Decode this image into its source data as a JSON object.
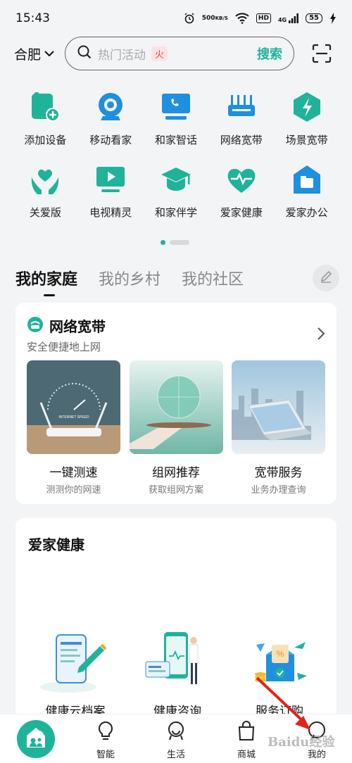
{
  "status_bar": {
    "time": "15:43",
    "net_speed_value": "500",
    "net_speed_unit": "KB/S",
    "hd": "HD",
    "signal": "4G",
    "battery": "55"
  },
  "search": {
    "city": "合肥",
    "placeholder": "热门活动",
    "hot_badge": "火",
    "button": "搜索"
  },
  "functions": [
    {
      "label": "添加设备",
      "icon": "add-device-icon"
    },
    {
      "label": "移动看家",
      "icon": "camera-icon"
    },
    {
      "label": "和家智话",
      "icon": "phone-screen-icon"
    },
    {
      "label": "网络宽带",
      "icon": "router-icon"
    },
    {
      "label": "场景宽带",
      "icon": "lightning-icon"
    },
    {
      "label": "关爱版",
      "icon": "care-hands-icon"
    },
    {
      "label": "电视精灵",
      "icon": "tv-icon"
    },
    {
      "label": "和家伴学",
      "icon": "graduation-cap-icon"
    },
    {
      "label": "爱家健康",
      "icon": "heart-pulse-icon"
    },
    {
      "label": "爱家办公",
      "icon": "office-folder-icon"
    }
  ],
  "tabs": [
    "我的家庭",
    "我的乡村",
    "我的社区"
  ],
  "broadband_card": {
    "title": "网络宽带",
    "subtitle": "安全便捷地上网",
    "items": [
      {
        "name": "一键测速",
        "desc": "测测你的网速",
        "img_text": "INTERNET SPEED"
      },
      {
        "name": "组网推荐",
        "desc": "获取组网方案"
      },
      {
        "name": "宽带服务",
        "desc": "业务办理查询"
      }
    ]
  },
  "health_card": {
    "title": "爱家健康",
    "items": [
      {
        "name": "健康云档案"
      },
      {
        "name": "健康咨询"
      },
      {
        "name": "服务订购"
      }
    ]
  },
  "bottom_nav": [
    {
      "label": "智能",
      "icon": "bulb-icon"
    },
    {
      "label": "生活",
      "icon": "smile-icon"
    },
    {
      "label": "商城",
      "icon": "bag-icon"
    },
    {
      "label": "我的",
      "icon": "chat-icon"
    }
  ],
  "watermark": "Baidu经验",
  "colors": {
    "accent": "#1fb39a",
    "icon_blue": "#1f8fe0",
    "background": "#f3f4f6"
  }
}
